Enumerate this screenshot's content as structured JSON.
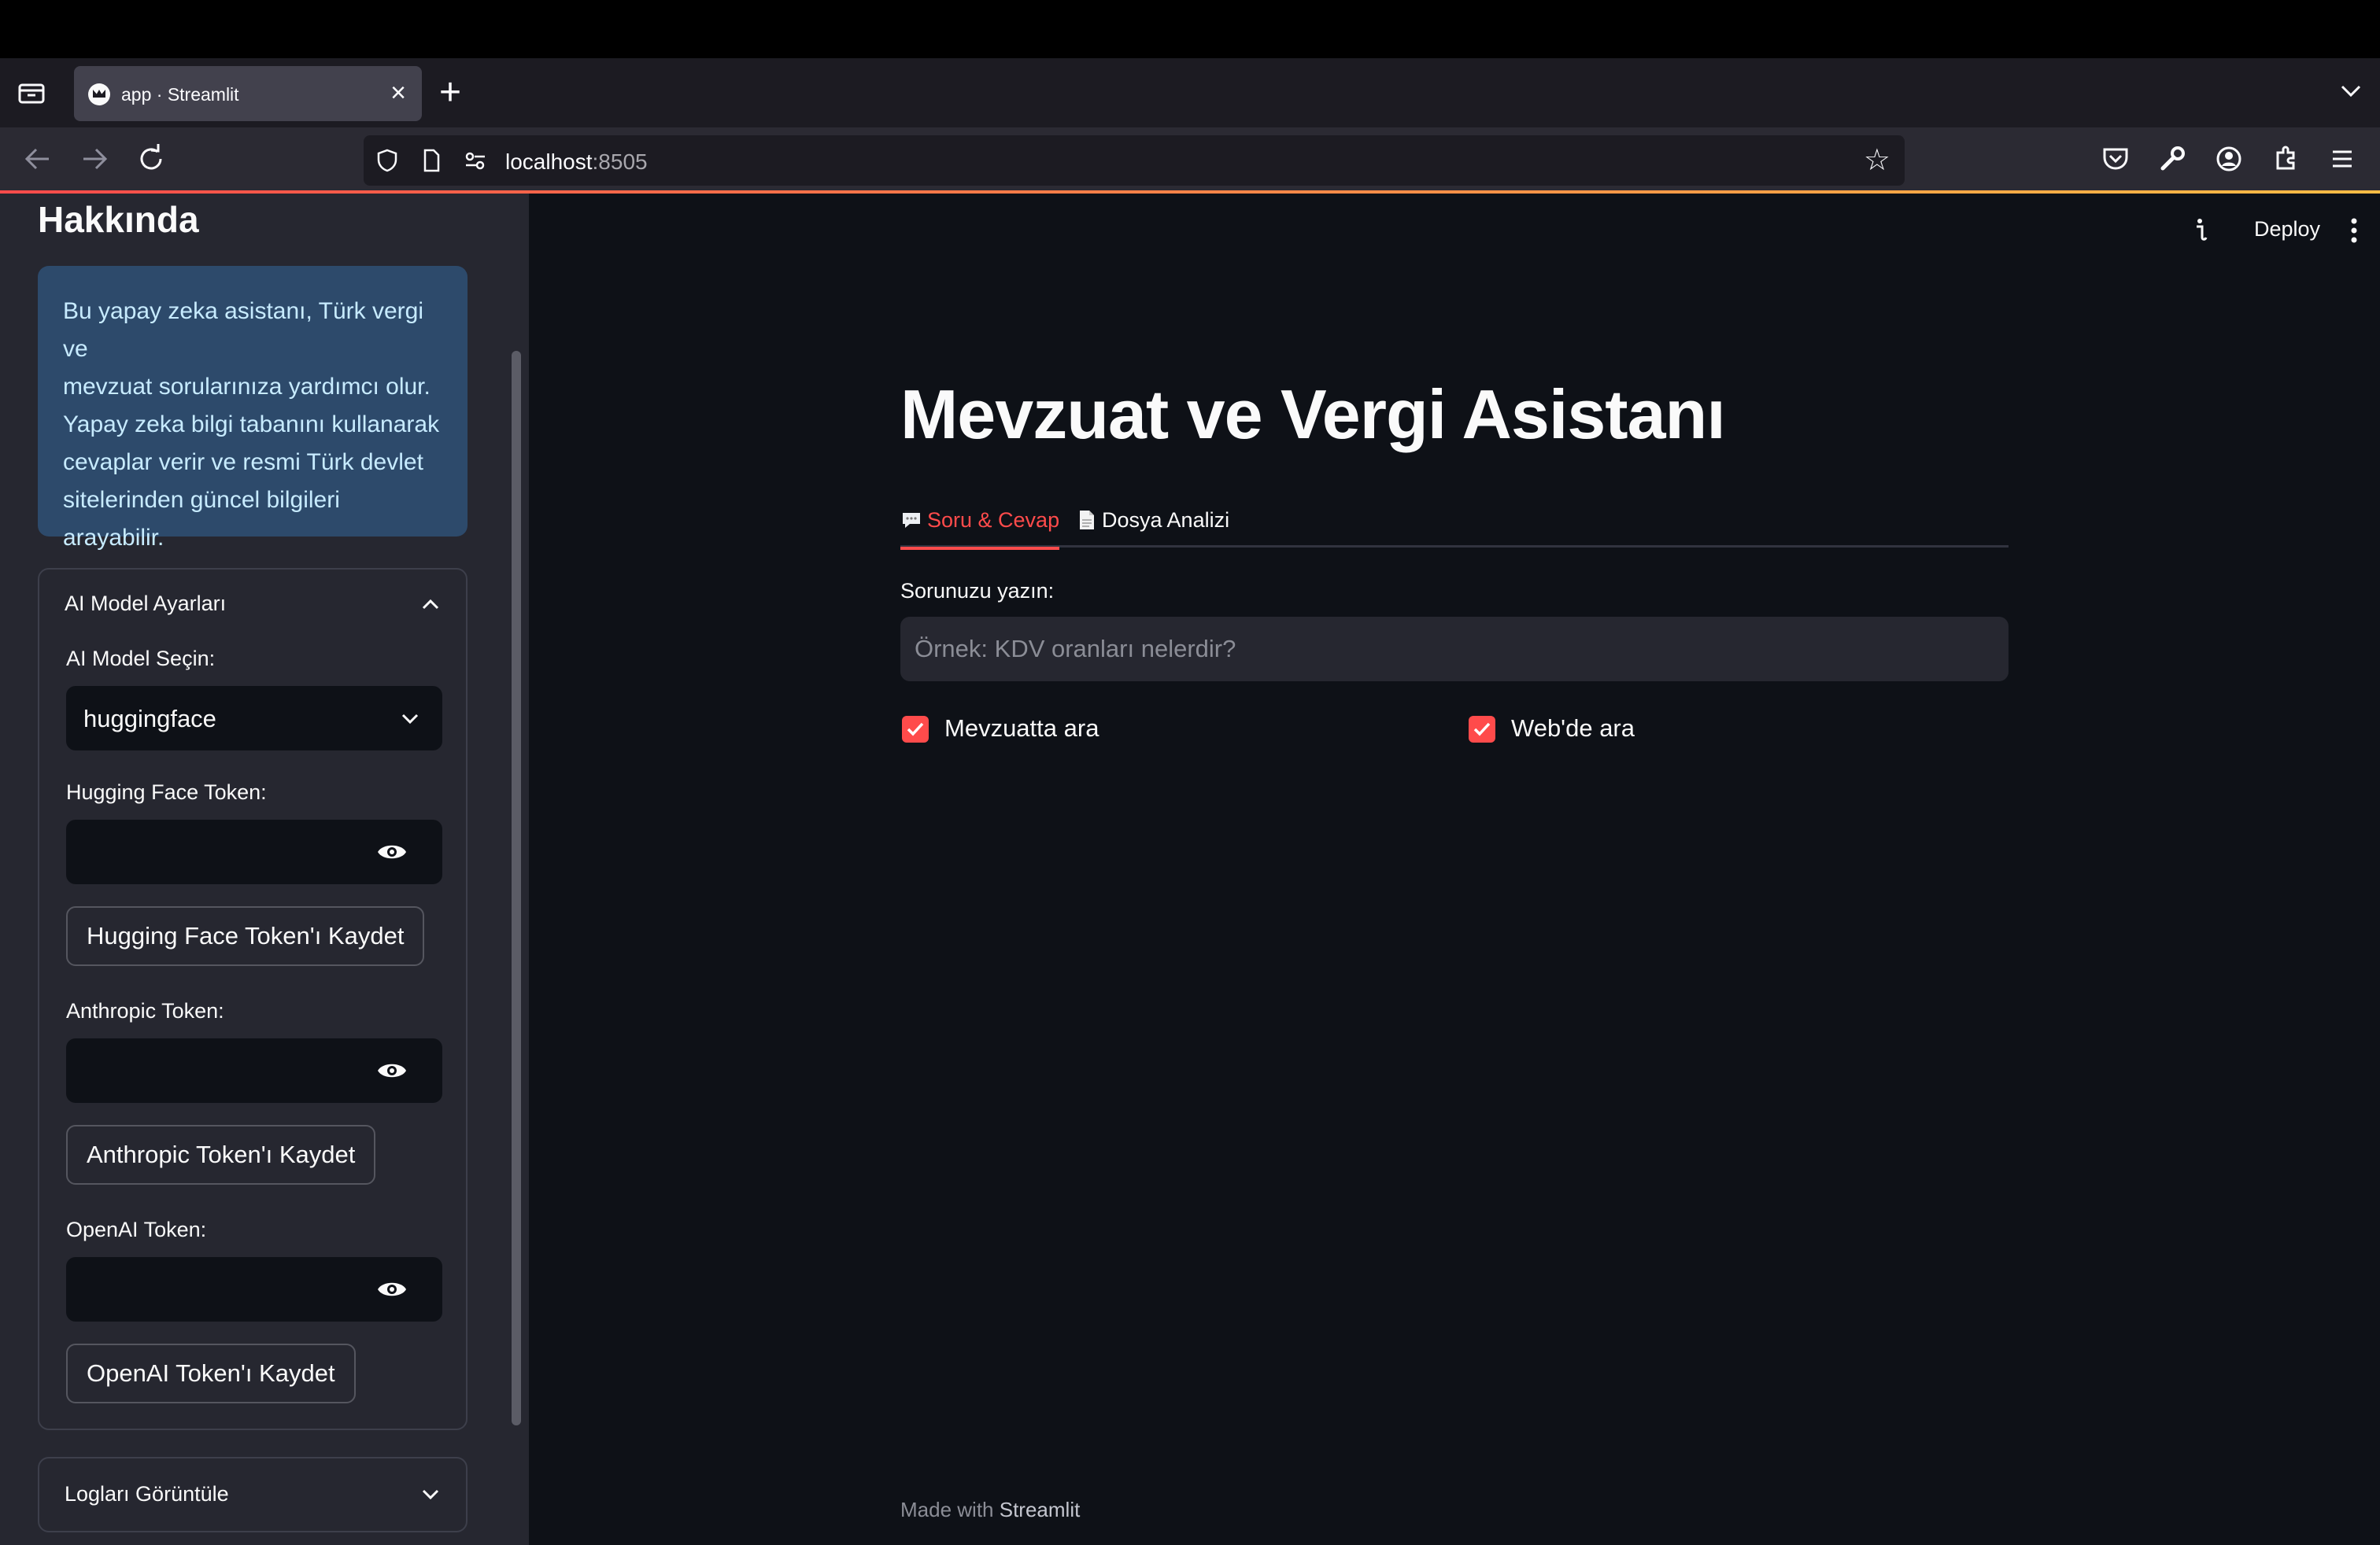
{
  "browser": {
    "tab_title": "app · Streamlit",
    "url_host": "localhost",
    "url_port": ":8505"
  },
  "sidebar": {
    "title": "Hakkında",
    "info_lines": [
      "Bu yapay zeka asistanı, Türk vergi ve",
      "mevzuat sorularınıza yardımcı olur.",
      "Yapay zeka bilgi tabanını kullanarak",
      "cevaplar verir ve resmi Türk devlet",
      "sitelerinden güncel bilgileri",
      "arayabilir."
    ],
    "model_expander": {
      "title": "AI Model Ayarları",
      "select_label": "AI Model Seçin:",
      "select_value": "huggingface",
      "hf_label": "Hugging Face Token:",
      "hf_button": "Hugging Face Token'ı Kaydet",
      "anthropic_label": "Anthropic Token:",
      "anthropic_button": "Anthropic Token'ı Kaydet",
      "openai_label": "OpenAI Token:",
      "openai_button": "OpenAI Token'ı Kaydet"
    },
    "logs_expander": {
      "title": "Logları Görüntüle"
    }
  },
  "header": {
    "deploy": "Deploy"
  },
  "main": {
    "title": "Mevzuat ve Vergi Asistanı",
    "tabs": [
      {
        "label": "Soru & Cevap",
        "icon": "speech-balloon-icon",
        "active": true
      },
      {
        "label": "Dosya Analizi",
        "icon": "document-icon",
        "active": false
      }
    ],
    "question_label": "Sorunuzu yazın:",
    "question_placeholder": "Örnek: KDV oranları nelerdir?",
    "question_value": "",
    "checkboxes": [
      {
        "label": "Mevzuatta ara",
        "checked": true
      },
      {
        "label": "Web'de ara",
        "checked": true
      }
    ]
  },
  "footer": {
    "prefix": "Made with",
    "brand": "Streamlit"
  },
  "colors": {
    "accent": "#ff4b4b",
    "info_bg": "#2d4a6b",
    "sidebar_bg": "#262730",
    "main_bg": "#0e1117"
  }
}
